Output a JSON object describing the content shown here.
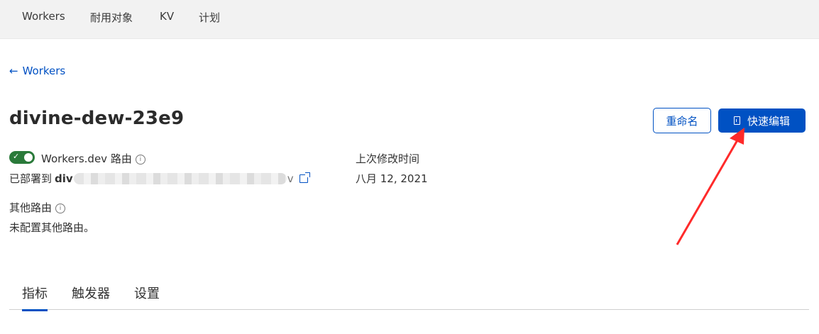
{
  "topnav": {
    "items": [
      {
        "label": "Workers"
      },
      {
        "label": "耐用对象"
      },
      {
        "label": "KV"
      },
      {
        "label": "计划"
      }
    ]
  },
  "back_link": {
    "label": "Workers"
  },
  "page_title": "divine-dew-23e9",
  "buttons": {
    "rename": "重命名",
    "quick_edit": "快速编辑"
  },
  "workers_dev": {
    "toggle_on": true,
    "label": "Workers.dev 路由",
    "deployed_prefix": "已部署到",
    "deployed_host_visible": "div",
    "deployed_host_tail": "v"
  },
  "last_modified": {
    "label": "上次修改时间",
    "value": "八月 12, 2021"
  },
  "other_routes": {
    "label": "其他路由",
    "value": "未配置其他路由。"
  },
  "tabs": [
    {
      "label": "指标",
      "active": true
    },
    {
      "label": "触发器",
      "active": false
    },
    {
      "label": "设置",
      "active": false
    }
  ],
  "colors": {
    "accent": "#0051c3",
    "toggle_on": "#2a7a3a",
    "annotation_arrow": "#ff2a2a"
  }
}
